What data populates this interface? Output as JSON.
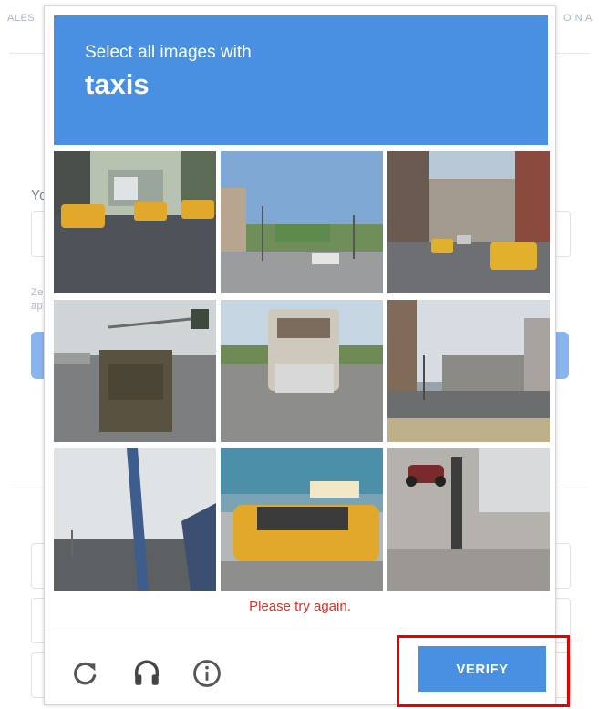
{
  "background": {
    "top_left_text": "ALES",
    "top_right_text": "OIN A",
    "left_partial_1": "Yo",
    "left_partial_2": "Ze",
    "left_partial_3": "ap"
  },
  "captcha": {
    "instruction": "Select all images with",
    "target": "taxis",
    "tiles": [
      {
        "name": "tile-1",
        "scene": "street with taxis"
      },
      {
        "name": "tile-2",
        "scene": "road with streetlights"
      },
      {
        "name": "tile-3",
        "scene": "city street with taxis"
      },
      {
        "name": "tile-4",
        "scene": "truck on highway"
      },
      {
        "name": "tile-5",
        "scene": "rv on road"
      },
      {
        "name": "tile-6",
        "scene": "street corner"
      },
      {
        "name": "tile-7",
        "scene": "pole and bridge"
      },
      {
        "name": "tile-8",
        "scene": "taxi close-up"
      },
      {
        "name": "tile-9",
        "scene": "motorcycle and pole"
      }
    ],
    "error_text": "Please try again.",
    "verify_label": "VERIFY",
    "icons": {
      "reload": "reload-icon",
      "audio": "headphones-icon",
      "info": "info-icon"
    },
    "colors": {
      "header": "#4a90e2",
      "verify": "#4a90e2",
      "error": "#d93025",
      "highlight": "#e60000"
    }
  }
}
